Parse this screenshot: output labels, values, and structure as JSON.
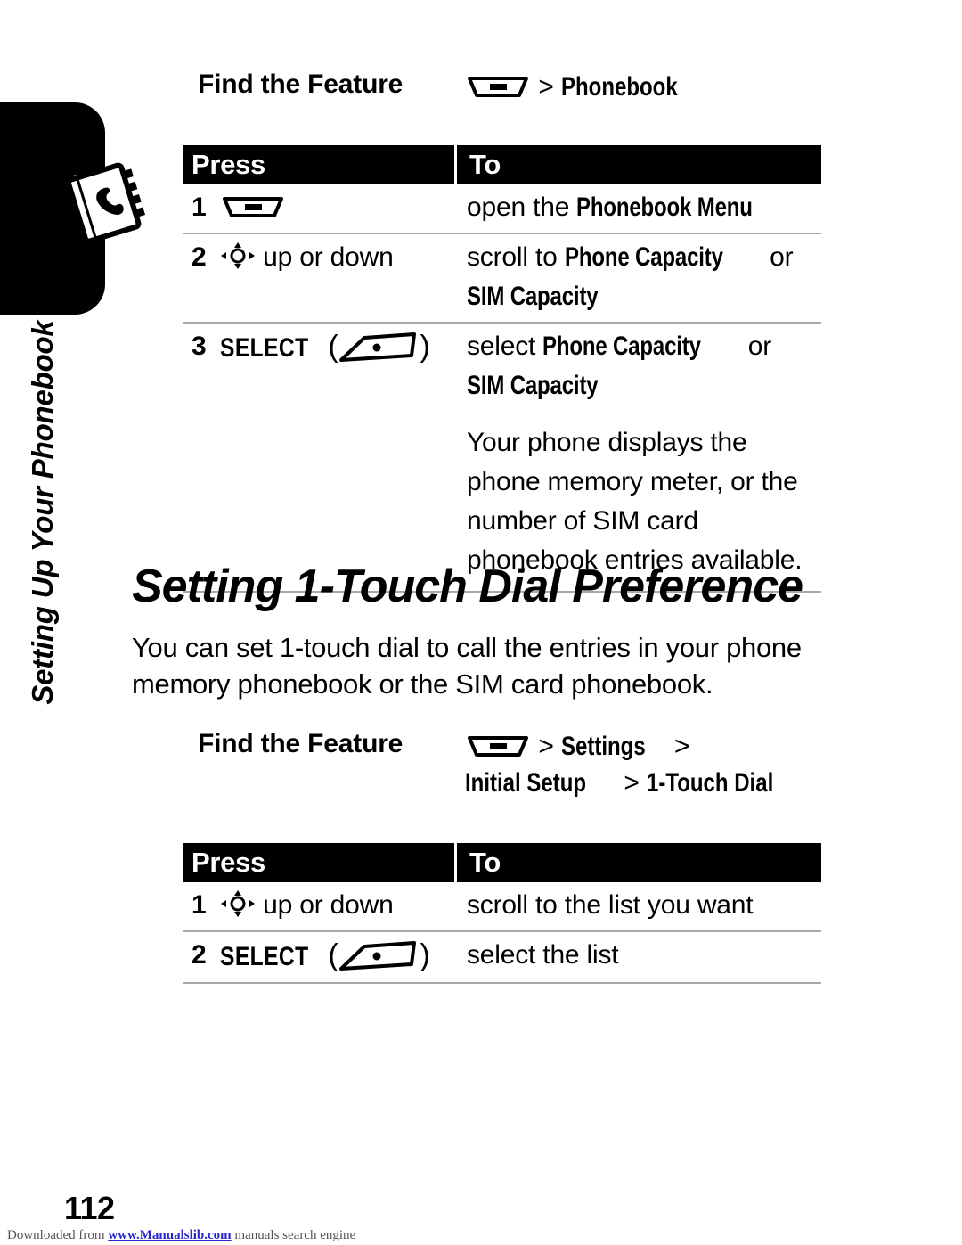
{
  "sidebar": {
    "chapter_label": "Setting Up Your Phonebook",
    "icon": "phonebook-address-book-icon"
  },
  "section_one": {
    "find_label": "Find the Feature",
    "path": {
      "key_icon": "menu-key-icon",
      "separator": ">",
      "items": [
        "Phonebook"
      ]
    },
    "table": {
      "header": {
        "press": "Press",
        "to": "To"
      },
      "rows": [
        {
          "num": "1",
          "press_icon": "menu-key-icon",
          "press_text": "",
          "to_parts": [
            {
              "text": "open the ",
              "style": "normal"
            },
            {
              "text": "Phonebook Menu",
              "style": "display"
            }
          ]
        },
        {
          "num": "2",
          "press_icon": "nav-key-icon",
          "press_text": "up or down",
          "to_parts": [
            {
              "text": "scroll to ",
              "style": "normal"
            },
            {
              "text": "Phone Capacity",
              "style": "display"
            },
            {
              "text": " or",
              "style": "normal"
            },
            {
              "text": "\n",
              "style": "break"
            },
            {
              "text": "SIM Capacity",
              "style": "display"
            }
          ]
        },
        {
          "num": "3",
          "press_icon": "soft-key-icon",
          "press_text": "SELECT",
          "to_parts": [
            {
              "text": "select ",
              "style": "normal"
            },
            {
              "text": "Phone Capacity",
              "style": "display"
            },
            {
              "text": " or",
              "style": "normal"
            },
            {
              "text": "\n",
              "style": "break"
            },
            {
              "text": "SIM Capacity",
              "style": "display"
            }
          ]
        }
      ],
      "note": "Your phone displays the phone memory meter, or the number of SIM card phonebook entries available.",
      "note_lines": [
        "Your phone displays the",
        "phone memory meter, or the",
        "number of SIM card",
        "phonebook entries available."
      ]
    }
  },
  "section_two": {
    "heading": "Setting 1-Touch Dial Preference",
    "intro_lines": [
      "You can set 1-touch dial to call the entries in your phone",
      "memory phonebook or the SIM card phonebook."
    ],
    "find_label": "Find the Feature",
    "path": {
      "key_icon": "menu-key-icon",
      "separator": ">",
      "items": [
        "Settings",
        "Initial Setup",
        "1-Touch Dial"
      ]
    },
    "table": {
      "header": {
        "press": "Press",
        "to": "To"
      },
      "rows": [
        {
          "num": "1",
          "press_icon": "nav-key-icon",
          "press_text": "up or down",
          "to_text": "scroll to the list you want"
        },
        {
          "num": "2",
          "press_icon": "soft-key-icon",
          "press_text": "SELECT",
          "to_text": "select the list"
        }
      ]
    }
  },
  "footer": {
    "page_number": "112",
    "download_prefix": "Downloaded from ",
    "download_link": "www.Manualslib.com",
    "download_suffix": " manuals search engine"
  },
  "colors": {
    "text": "#000000",
    "header_bar": "#000000",
    "header_text": "#ffffff",
    "rule": "#a8a8a8",
    "link": "#2727d0",
    "footer_text": "#555555"
  }
}
